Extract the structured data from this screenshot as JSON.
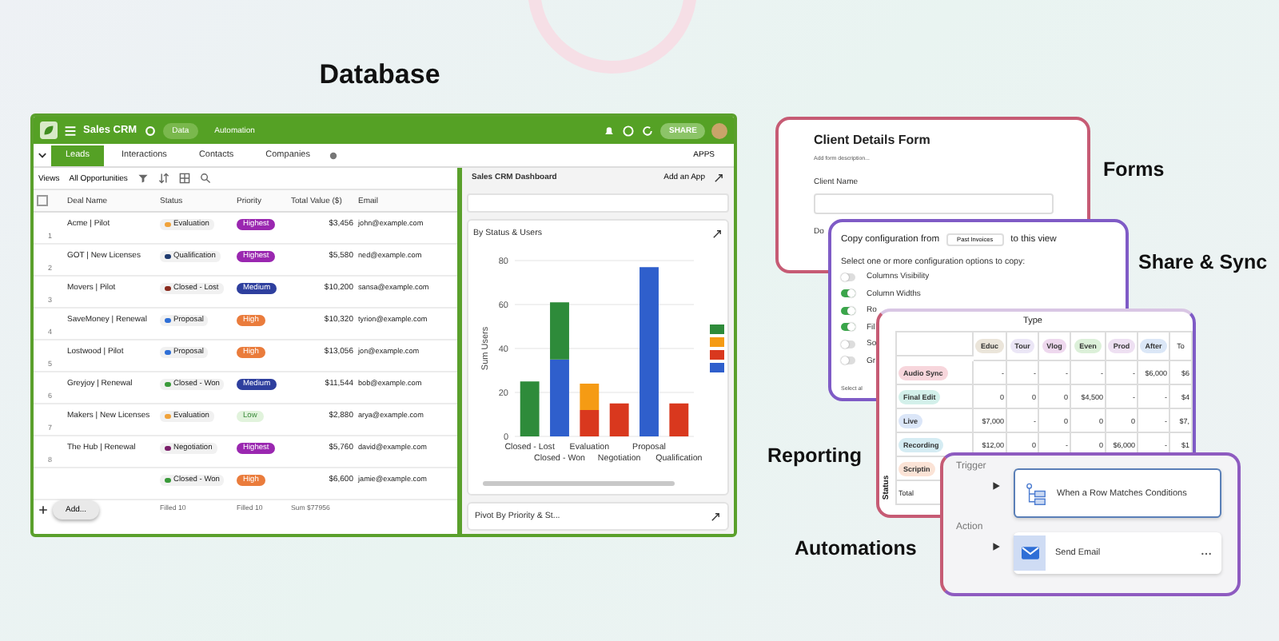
{
  "database_heading": "Database",
  "app": {
    "title": "Sales CRM",
    "share_button": "SHARE",
    "apps_button": "APPS",
    "top_tabs": [
      {
        "label": "Data",
        "selected": true
      },
      {
        "label": "Automation",
        "selected": false
      }
    ],
    "tabs": [
      {
        "label": "Leads",
        "selected": true
      },
      {
        "label": "Interactions",
        "selected": false
      },
      {
        "label": "Contacts",
        "selected": false
      },
      {
        "label": "Companies",
        "selected": false
      }
    ],
    "toolbar": {
      "views": "Views",
      "view_name": "All Opportunities"
    },
    "select_all_checked": false,
    "table": {
      "columns": [
        "Deal Name",
        "Status",
        "Priority",
        "Total Value ($)",
        "Email"
      ],
      "rows": [
        {
          "index": "1",
          "deal": "Acme | Pilot",
          "status": {
            "label": "Evaluation",
            "color": "#f0a23a"
          },
          "priority": {
            "label": "Highest",
            "kind": "highest"
          },
          "value": "$3,456",
          "email": "john@example.com"
        },
        {
          "index": "2",
          "deal": "GOT | New Licenses",
          "status": {
            "label": "Qualification",
            "color": "#1f3a6e"
          },
          "priority": {
            "label": "Highest",
            "kind": "highest"
          },
          "value": "$5,580",
          "email": "ned@example.com"
        },
        {
          "index": "3",
          "deal": "Movers | Pilot",
          "status": {
            "label": "Closed - Lost",
            "color": "#8a2b1e"
          },
          "priority": {
            "label": "Medium",
            "kind": "medium"
          },
          "value": "$10,200",
          "email": "sansa@example.com"
        },
        {
          "index": "4",
          "deal": "SaveMoney | Renewal",
          "status": {
            "label": "Proposal",
            "color": "#2f6fd6"
          },
          "priority": {
            "label": "High",
            "kind": "high"
          },
          "value": "$10,320",
          "email": "tyrion@example.com"
        },
        {
          "index": "5",
          "deal": "Lostwood | Pilot",
          "status": {
            "label": "Proposal",
            "color": "#2f6fd6"
          },
          "priority": {
            "label": "High",
            "kind": "high"
          },
          "value": "$13,056",
          "email": "jon@example.com"
        },
        {
          "index": "6",
          "deal": "Greyjoy | Renewal",
          "status": {
            "label": "Closed - Won",
            "color": "#3a9a3a"
          },
          "priority": {
            "label": "Medium",
            "kind": "medium"
          },
          "value": "$11,544",
          "email": "bob@example.com"
        },
        {
          "index": "7",
          "deal": "Makers | New Licenses",
          "status": {
            "label": "Evaluation",
            "color": "#f0a23a"
          },
          "priority": {
            "label": "Low",
            "kind": "low"
          },
          "value": "$2,880",
          "email": "arya@example.com"
        },
        {
          "index": "8",
          "deal": "The Hub | Renewal",
          "status": {
            "label": "Negotiation",
            "color": "#7a1f6a"
          },
          "priority": {
            "label": "Highest",
            "kind": "highest"
          },
          "value": "$5,760",
          "email": "david@example.com"
        },
        {
          "status": {
            "label": "Closed - Won",
            "color": "#3a9a3a"
          },
          "priority": {
            "label": "High",
            "kind": "high"
          },
          "value": "$6,600",
          "email": "jamie@example.com"
        }
      ],
      "footer": [
        "Filled 10",
        "Filled 10",
        "Sum $77956"
      ]
    },
    "add_button": "Add...",
    "dashboard": {
      "title": "Sales CRM Dashboard",
      "add_app": "Add an App",
      "chart_card": {
        "title": "By Status & Users",
        "chart_data": {
          "type": "bar",
          "ylabel": "Sum Users",
          "categories": [
            "Closed - Lost",
            "Closed - Won",
            "Evaluation",
            "Negotiation",
            "Proposal",
            "Qualification"
          ],
          "stacked": true,
          "grid": true,
          "ylim": [
            0,
            80
          ],
          "yticks": [
            0,
            20,
            40,
            60,
            80
          ],
          "series": [
            {
              "color": "#2e8b3a",
              "values": [
                25,
                26,
                null,
                null,
                null,
                null
              ]
            },
            {
              "color": "#f59b14",
              "values": [
                null,
                null,
                12,
                null,
                null,
                null
              ]
            },
            {
              "color": "#d9381e",
              "values": [
                null,
                null,
                12,
                15,
                null,
                15
              ]
            },
            {
              "color": "#2f5fcc",
              "values": [
                null,
                35,
                null,
                null,
                77,
                null
              ]
            }
          ]
        }
      },
      "pivot_card": {
        "title": "Pivot By Priority & St..."
      }
    }
  },
  "forms": {
    "label": "Forms",
    "title": "Client Details Form",
    "description": "Add form description...",
    "field_label": "Client Name",
    "next_label": "Do"
  },
  "share_sync": {
    "label": "Share & Sync",
    "copy_from": "Copy configuration from",
    "source": "Past Invoices",
    "to_view": "to this view",
    "prompt": "Select one or more configuration options to copy:",
    "options": [
      {
        "label": "Columns Visibility",
        "on": false
      },
      {
        "label": "Column Widths",
        "on": true
      },
      {
        "label": "Ro",
        "on": true
      },
      {
        "label": "Fil",
        "on": true
      },
      {
        "label": "So",
        "on": false
      },
      {
        "label": "Gr",
        "on": false
      }
    ],
    "footer": "Select al"
  },
  "reporting": {
    "label": "Reporting",
    "title": "Type",
    "axis_label": "Status",
    "columns": [
      {
        "label": "Educ",
        "color": "#ebe5da"
      },
      {
        "label": "Tour",
        "color": "#ebe6f6"
      },
      {
        "label": "Vlog",
        "color": "#eed8ee"
      },
      {
        "label": "Even",
        "color": "#dcf0d9"
      },
      {
        "label": "Prod",
        "color": "#eee0f2"
      },
      {
        "label": "After",
        "color": "#dbe7f7"
      },
      {
        "label": "To"
      }
    ],
    "rows": [
      {
        "label": "Audio Sync",
        "color": "#f7d6dc",
        "cells": [
          "-",
          "-",
          "-",
          "-",
          "-",
          "$6,000",
          "$6"
        ]
      },
      {
        "label": "Final Edit",
        "color": "#d3f0ea",
        "cells": [
          "0",
          "0",
          "0",
          "$4,500",
          "-",
          "-",
          "$4"
        ]
      },
      {
        "label": "Live",
        "color": "#dbe6f8",
        "cells": [
          "$7,000",
          "-",
          "0",
          "0",
          "0",
          "-",
          "$7,"
        ]
      },
      {
        "label": "Recording",
        "color": "#d5ecf3",
        "cells": [
          "$12,00",
          "0",
          "-",
          "0",
          "$6,000",
          "-",
          "$1"
        ]
      },
      {
        "label": "Scriptin",
        "color": "#fbe3d6",
        "cells": []
      },
      {
        "label": "Total",
        "cells": []
      }
    ]
  },
  "automations": {
    "label": "Automations",
    "steps": [
      {
        "stage": "Trigger",
        "kind": "trigger",
        "text": "When a Row Matches Conditions"
      },
      {
        "stage": "Action",
        "kind": "action",
        "text": "Send Email"
      }
    ]
  }
}
